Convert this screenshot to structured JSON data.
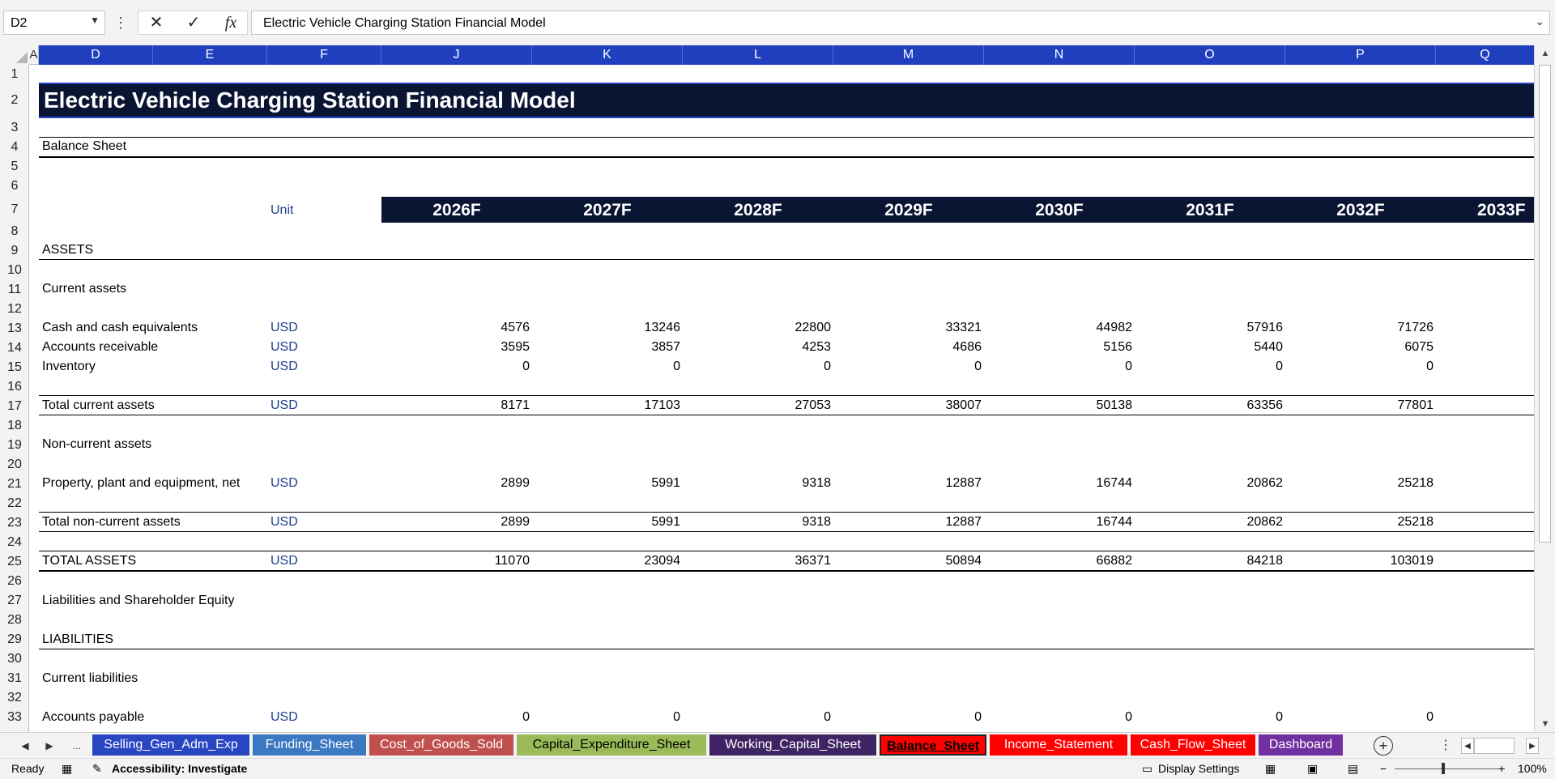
{
  "formula_bar": {
    "name_box": "D2",
    "more_icon": "⋮",
    "cancel_icon": "✕",
    "enter_icon": "✓",
    "fx_label": "fx",
    "formula": "Electric Vehicle Charging Station Financial Model"
  },
  "columns": [
    "D",
    "E",
    "F",
    "J",
    "K",
    "L",
    "M",
    "N",
    "O",
    "P",
    "Q"
  ],
  "col_a": "A",
  "rows": [
    "1",
    "2",
    "3",
    "4",
    "5",
    "6",
    "7",
    "8",
    "9",
    "10",
    "11",
    "12",
    "13",
    "14",
    "15",
    "16",
    "17",
    "18",
    "19",
    "20",
    "21",
    "22",
    "23",
    "24",
    "25",
    "26",
    "27",
    "28",
    "29",
    "30",
    "31",
    "32",
    "33"
  ],
  "sheet": {
    "title": "Electric Vehicle Charging Station Financial Model",
    "section": "Balance Sheet",
    "unit_header": "Unit",
    "years": [
      "2026F",
      "2027F",
      "2028F",
      "2029F",
      "2030F",
      "2031F",
      "2032F",
      "2033F"
    ],
    "assets_header": "ASSETS",
    "current_assets_header": "Current assets",
    "cash": {
      "label": "Cash and cash equivalents",
      "unit": "USD",
      "values": [
        "4576",
        "13246",
        "22800",
        "33321",
        "44982",
        "57916",
        "71726"
      ]
    },
    "ar": {
      "label": "Accounts receivable",
      "unit": "USD",
      "values": [
        "3595",
        "3857",
        "4253",
        "4686",
        "5156",
        "5440",
        "6075"
      ]
    },
    "inventory": {
      "label": "Inventory",
      "unit": "USD",
      "values": [
        "0",
        "0",
        "0",
        "0",
        "0",
        "0",
        "0"
      ]
    },
    "total_current": {
      "label": "Total current assets",
      "unit": "USD",
      "values": [
        "8171",
        "17103",
        "27053",
        "38007",
        "50138",
        "63356",
        "77801"
      ]
    },
    "noncurrent_header": "Non-current assets",
    "ppe": {
      "label": "Property, plant and equipment, net",
      "unit": "USD",
      "values": [
        "2899",
        "5991",
        "9318",
        "12887",
        "16744",
        "20862",
        "25218"
      ]
    },
    "total_noncurrent": {
      "label": "Total non-current assets",
      "unit": "USD",
      "values": [
        "2899",
        "5991",
        "9318",
        "12887",
        "16744",
        "20862",
        "25218"
      ]
    },
    "total_assets": {
      "label": "TOTAL ASSETS",
      "unit": "USD",
      "values": [
        "11070",
        "23094",
        "36371",
        "50894",
        "66882",
        "84218",
        "103019"
      ]
    },
    "liab_equity_header": "Liabilities and Shareholder Equity",
    "liabilities_header": "LIABILITIES",
    "current_liab_header": "Current liabilities",
    "ap": {
      "label": "Accounts payable",
      "unit": "USD",
      "values": [
        "0",
        "0",
        "0",
        "0",
        "0",
        "0",
        "0"
      ]
    }
  },
  "tabs": [
    {
      "label": "Selling_Gen_Adm_Exp",
      "color": "#2845c2"
    },
    {
      "label": "Funding_Sheet",
      "color": "#3a78c2"
    },
    {
      "label": "Cost_of_Goods_Sold",
      "color": "#c0504d"
    },
    {
      "label": "Capital_Expenditure_Sheet",
      "color": "#9bbb59"
    },
    {
      "label": "Working_Capital_Sheet",
      "color": "#3f2463"
    },
    {
      "label": "Balance_Sheet",
      "color": "#ff0000"
    },
    {
      "label": "Income_Statement",
      "color": "#ff0000"
    },
    {
      "label": "Cash_Flow_Sheet",
      "color": "#ff0000"
    },
    {
      "label": "Dashboard",
      "color": "#7030a0"
    }
  ],
  "tab_nav": {
    "prev": "◀",
    "next": "▶",
    "more": "..."
  },
  "status": {
    "ready": "Ready",
    "accessibility": "Accessibility: Investigate",
    "display_settings": "Display Settings",
    "zoom_minus": "−",
    "zoom_plus": "+",
    "zoom": "100%"
  }
}
